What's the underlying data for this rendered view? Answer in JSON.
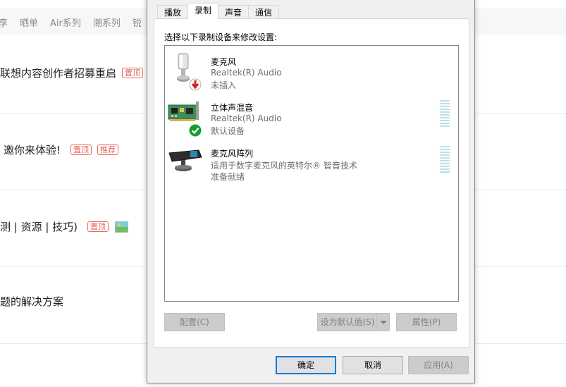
{
  "background_page": {
    "nav": [
      "享",
      "晒单",
      "Air系列",
      "潮系列",
      "锐"
    ],
    "rows": [
      {
        "text": "联想内容创作者招募重启",
        "tags": [
          "置顶"
        ],
        "image": false
      },
      {
        "text": "邀你来体验!",
        "tags": [
          "置顶",
          "推荐"
        ],
        "image": false
      },
      {
        "text": "测 | 资源 | 技巧)",
        "tags": [
          "置顶"
        ],
        "image": true
      },
      {
        "text": "题的解决方案",
        "tags": [],
        "image": false
      }
    ]
  },
  "dialog": {
    "tabs": [
      "播放",
      "录制",
      "声音",
      "通信"
    ],
    "active_tab": 1,
    "instruction": "选择以下录制设备来修改设置:",
    "devices": [
      {
        "name": "麦克风",
        "driver": "Realtek(R) Audio",
        "status": "未插入",
        "icon": "microphone-icon",
        "badge": "unplugged-badge-icon",
        "level_meter": false
      },
      {
        "name": "立体声混音",
        "driver": "Realtek(R) Audio",
        "status": "默认设备",
        "icon": "sound-card-icon",
        "badge": "default-check-icon",
        "level_meter": true
      },
      {
        "name": "麦克风阵列",
        "driver": "适用于数字麦克风的英特尔® 智音技术",
        "status": "准备就绪",
        "icon": "microphone-array-icon",
        "badge": "",
        "level_meter": true
      }
    ],
    "buttons": {
      "configure": "配置(C)",
      "set_default": "设为默认值(S)",
      "properties": "属性(P)",
      "ok": "确定",
      "cancel": "取消",
      "apply": "应用(A)"
    },
    "colors": {
      "accent": "#0078d7",
      "tag_red": "#e36a5c",
      "check_green": "#1a9c2e",
      "unplug_red": "#d42020"
    }
  }
}
